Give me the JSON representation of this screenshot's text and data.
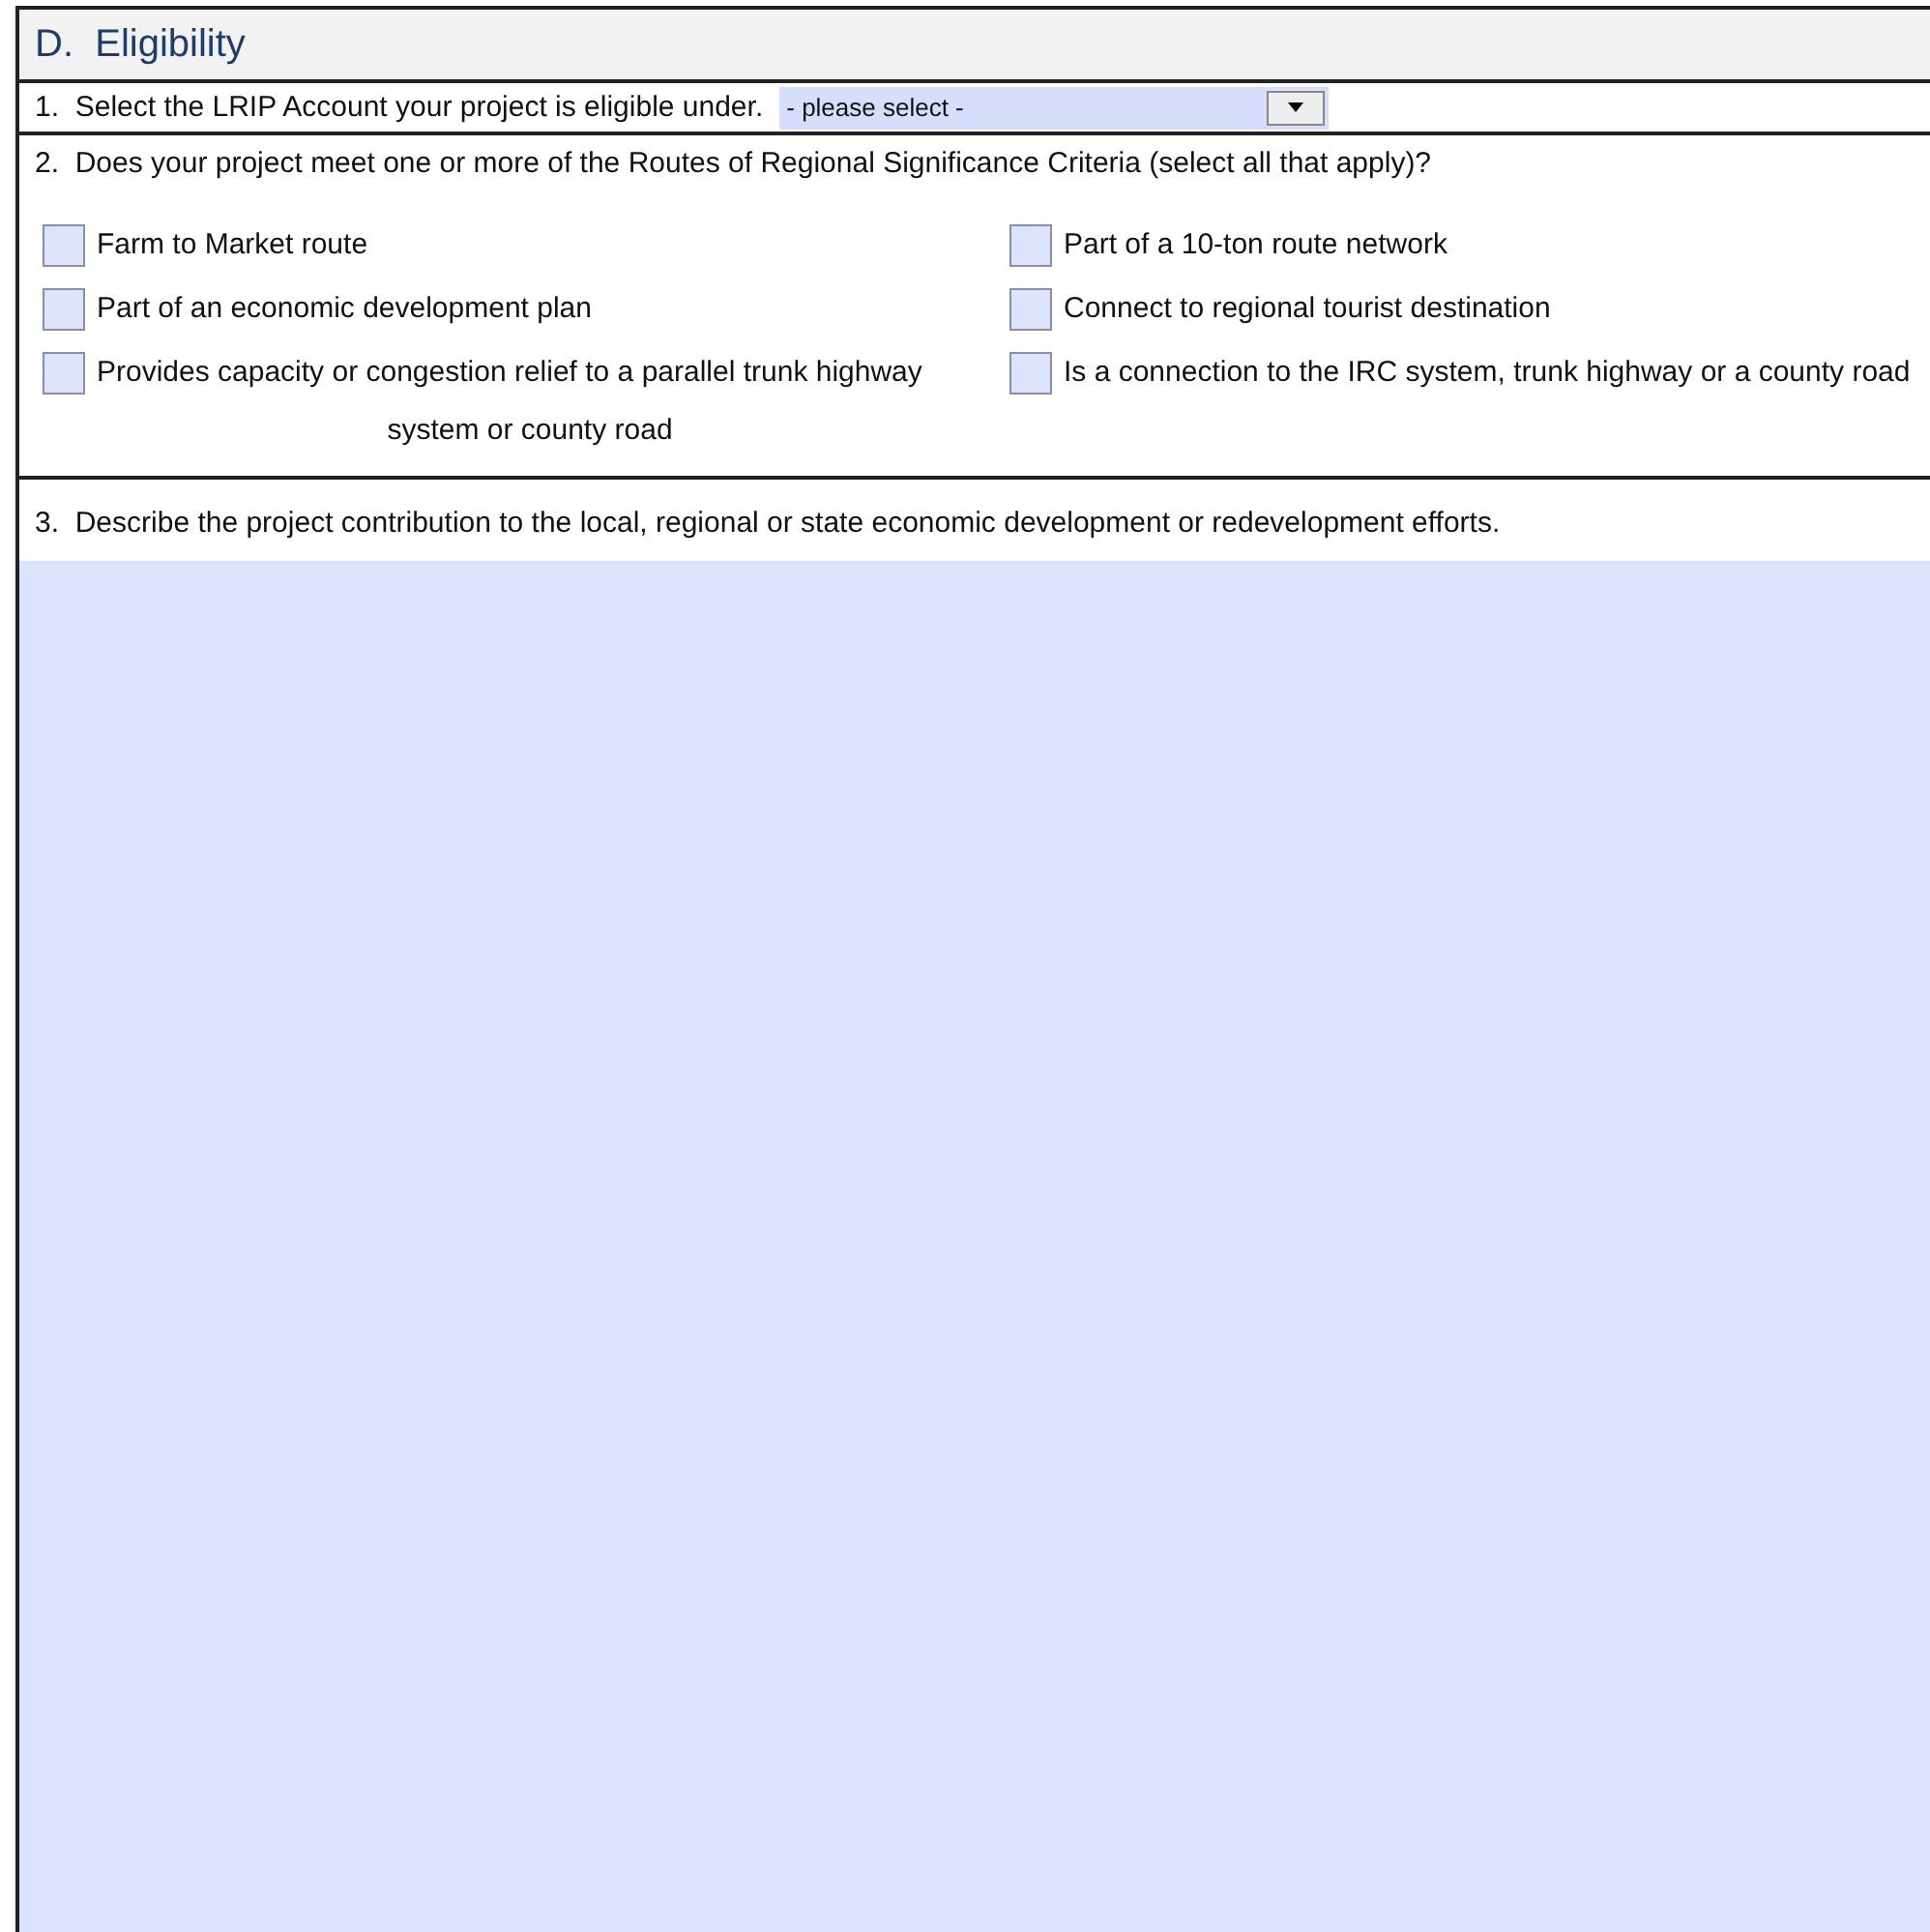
{
  "section": {
    "title": "D.  Eligibility"
  },
  "question_1": {
    "label": "1.  Select the LRIP Account your project is eligible under.",
    "select": {
      "value": "- please select -"
    }
  },
  "question_2": {
    "label": "2.  Does your project meet one or more of the Routes of Regional Significance Criteria (select all that apply)?",
    "options": [
      {
        "label": "Farm to Market route",
        "checked": false
      },
      {
        "label": "Part of a 10-ton route network",
        "checked": false
      },
      {
        "label": "Part of an economic development plan",
        "checked": false
      },
      {
        "label": "Connect to regional tourist destination",
        "checked": false
      },
      {
        "label": "Provides capacity or congestion relief to a parallel trunk highway system or county road",
        "checked": false
      },
      {
        "label": "Is a connection to the IRC system, trunk highway or a county road",
        "checked": false
      }
    ]
  },
  "question_3": {
    "label": "3.  Describe the project contribution to the local, regional or state economic development or redevelopment efforts."
  }
}
